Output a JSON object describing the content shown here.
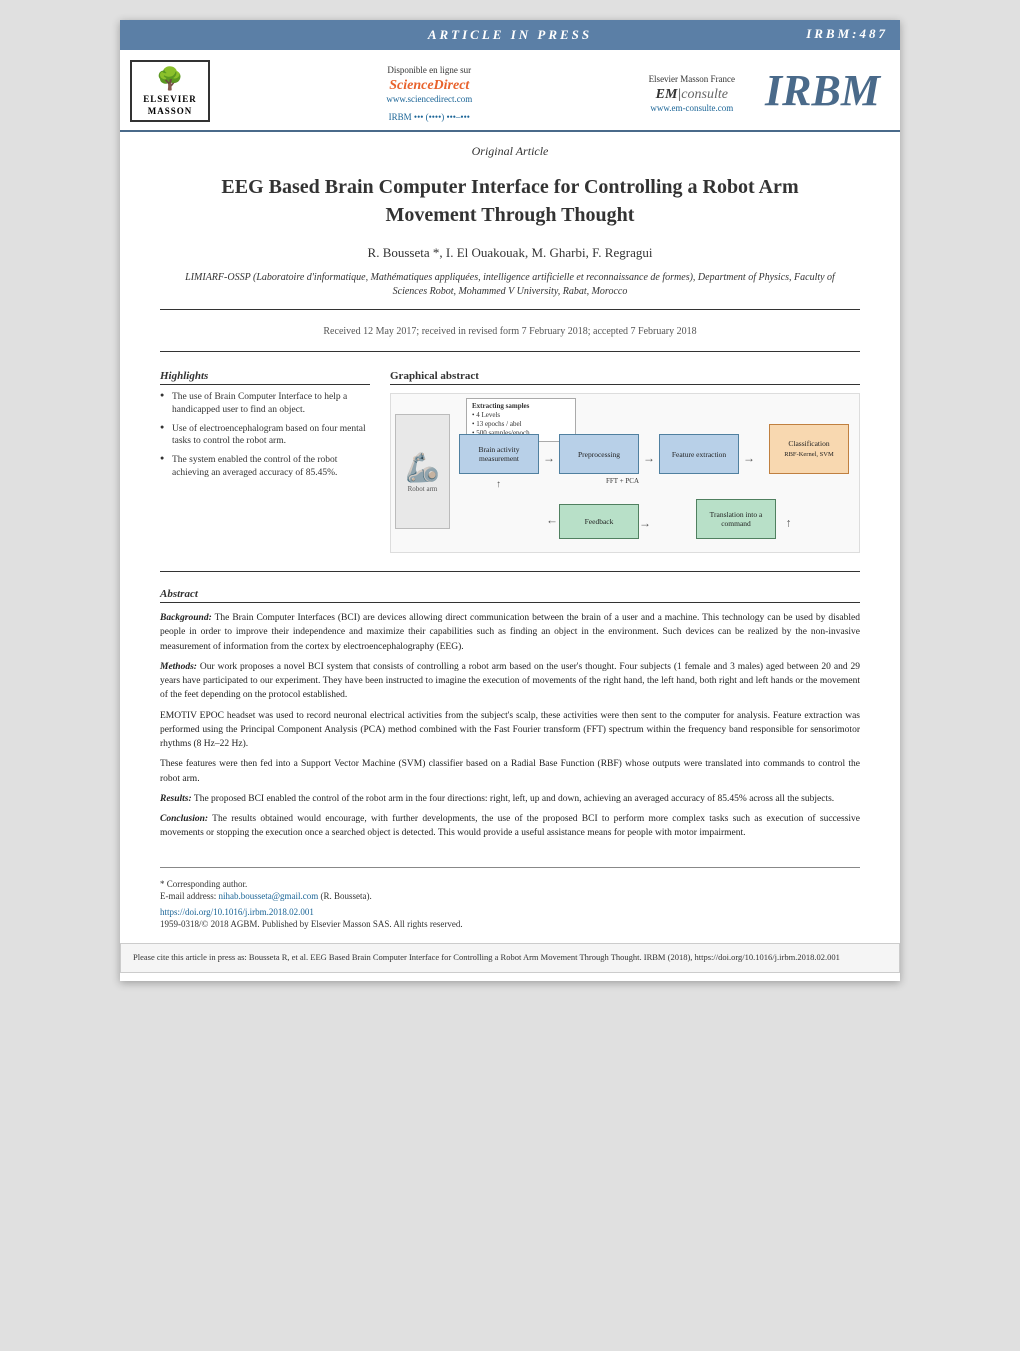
{
  "banner": {
    "text": "ARTICLE IN PRESS",
    "id": "IRBM:487"
  },
  "logos": {
    "disponible": "Disponible en ligne sur",
    "sciencedirect_name": "ScienceDirect",
    "sciencedirect_url": "www.sciencedirect.com",
    "irbm_contact": "IRBM ••• (••••) •••–•••",
    "elsevier_masson": "Elsevier Masson France",
    "em_consulte": "EM|consulte",
    "em_url": "www.em-consulte.com",
    "irbm_logo": "IRBM",
    "elsevier_name1": "ELSEVIER",
    "elsevier_name2": "MASSON"
  },
  "article": {
    "type": "Original Article",
    "title_line1": "EEG Based Brain Computer Interface for Controlling a Robot Arm",
    "title_line2": "Movement Through Thought",
    "authors": "R. Bousseta *, I. El Ouakouak, M. Gharbi, F. Regragui",
    "affiliation": "LIMIARF-OSSP (Laboratoire d'informatique, Mathématiques appliquées, intelligence artificielle et reconnaissance de formes), Department of Physics, Faculty of Sciences Robot, Mohammed V University, Rabat, Morocco",
    "dates": "Received 12 May 2017; received in revised form 7 February 2018; accepted 7 February 2018"
  },
  "highlights": {
    "heading": "Highlights",
    "items": [
      "The use of Brain Computer Interface to help a handicapped user to find an object.",
      "Use of electroencephalogram based on four mental tasks to control the robot arm.",
      "The system enabled the control of the robot achieving an averaged accuracy of 85.45%."
    ]
  },
  "graphical_abstract": {
    "heading": "Graphical abstract",
    "boxes": {
      "brain_activity": "Brain activity measurement",
      "preprocessing": "Preprocessing",
      "feature_extraction": "Feature extraction",
      "classification": "Classification",
      "feedback": "Feedback",
      "translation": "Translation into a command",
      "rbf_svm": "RBF-Kernel, SVM",
      "fft_pca": "FFT + PCA"
    },
    "note_title": "Extracting samples",
    "note_items": [
      "• 4 Levels",
      "• 13 epochs / abel",
      "• 500 samples/epoch"
    ]
  },
  "abstract": {
    "heading": "Abstract",
    "background_label": "Background:",
    "background": "The Brain Computer Interfaces (BCI) are devices allowing direct communication between the brain of a user and a machine. This technology can be used by disabled people in order to improve their independence and maximize their capabilities such as finding an object in the environment. Such devices can be realized by the non-invasive measurement of information from the cortex by electroencephalography (EEG).",
    "methods_label": "Methods:",
    "methods": "Our work proposes a novel BCI system that consists of controlling a robot arm based on the user's thought. Four subjects (1 female and 3 males) aged between 20 and 29 years have participated to our experiment. They have been instructed to imagine the execution of movements of the right hand, the left hand, both right and left hands or the movement of the feet depending on the protocol established.",
    "methods2": "EMOTIV EPOC headset was used to record neuronal electrical activities from the subject's scalp, these activities were then sent to the computer for analysis. Feature extraction was performed using the Principal Component Analysis (PCA) method combined with the Fast Fourier transform (FFT) spectrum within the frequency band responsible for sensorimotor rhythms (8 Hz–22 Hz).",
    "methods3": "These features were then fed into a Support Vector Machine (SVM) classifier based on a Radial Base Function (RBF) whose outputs were translated into commands to control the robot arm.",
    "results_label": "Results:",
    "results": "The proposed BCI enabled the control of the robot arm in the four directions: right, left, up and down, achieving an averaged accuracy of 85.45% across all the subjects.",
    "conclusion_label": "Conclusion:",
    "conclusion": "The results obtained would encourage, with further developments, the use of the proposed BCI to perform more complex tasks such as execution of successive movements or stopping the execution once a searched object is detected. This would provide a useful assistance means for people with motor impairment."
  },
  "footnote": {
    "corresponding": "* Corresponding author.",
    "email_label": "E-mail address:",
    "email": "nihab.bousseta@gmail.com",
    "email_suffix": " (R. Bousseta).",
    "doi": "https://doi.org/10.1016/j.irbm.2018.02.001",
    "copyright": "1959-0318/© 2018 AGBM. Published by Elsevier Masson SAS. All rights reserved."
  },
  "citation": {
    "text": "Please cite this article in press as: Bousseta R, et al. EEG Based Brain Computer Interface for Controlling a Robot Arm Movement Through Thought. IRBM (2018), https://doi.org/10.1016/j.irbm.2018.02.001"
  }
}
